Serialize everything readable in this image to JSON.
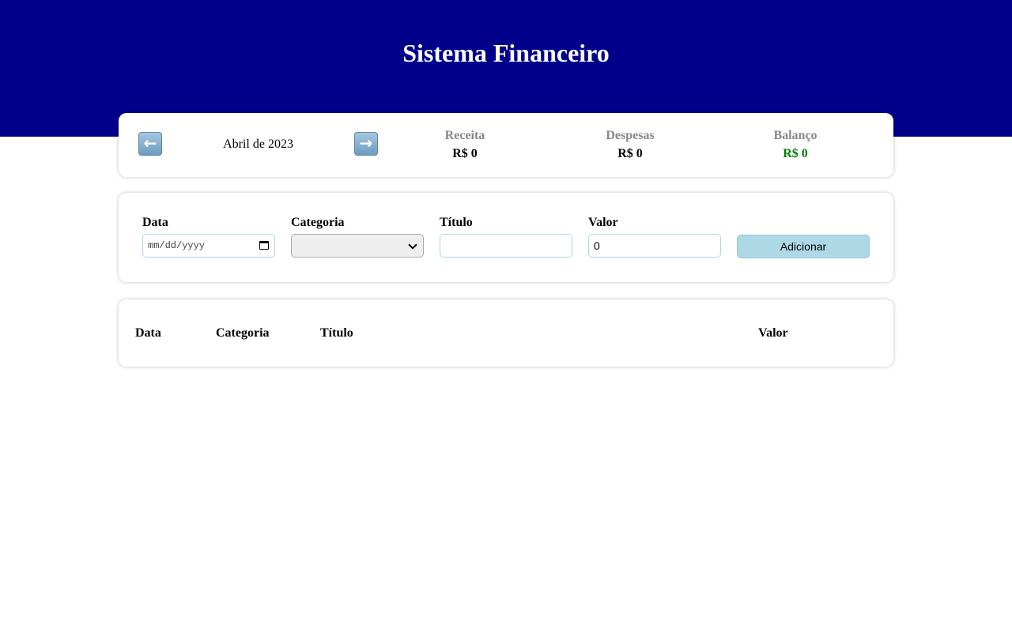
{
  "header": {
    "title": "Sistema Financeiro",
    "background_color": "#00008b"
  },
  "info": {
    "month_label": "Abril de 2023",
    "prev_icon": "left-arrow-icon",
    "next_icon": "right-arrow-icon",
    "receita": {
      "title": "Receita",
      "value": "R$ 0"
    },
    "despesas": {
      "title": "Despesas",
      "value": "R$ 0"
    },
    "balanco": {
      "title": "Balanço",
      "value": "R$ 0",
      "color": "#008000"
    }
  },
  "form": {
    "data": {
      "label": "Data",
      "placeholder": "mm/dd/yyyy"
    },
    "categoria": {
      "label": "Categoria",
      "selected": ""
    },
    "titulo": {
      "label": "Título",
      "value": ""
    },
    "valor": {
      "label": "Valor",
      "value": "0"
    },
    "add_button": "Adicionar",
    "accent_color": "#add8e6"
  },
  "table": {
    "columns": [
      "Data",
      "Categoria",
      "Título",
      "Valor"
    ],
    "rows": []
  }
}
